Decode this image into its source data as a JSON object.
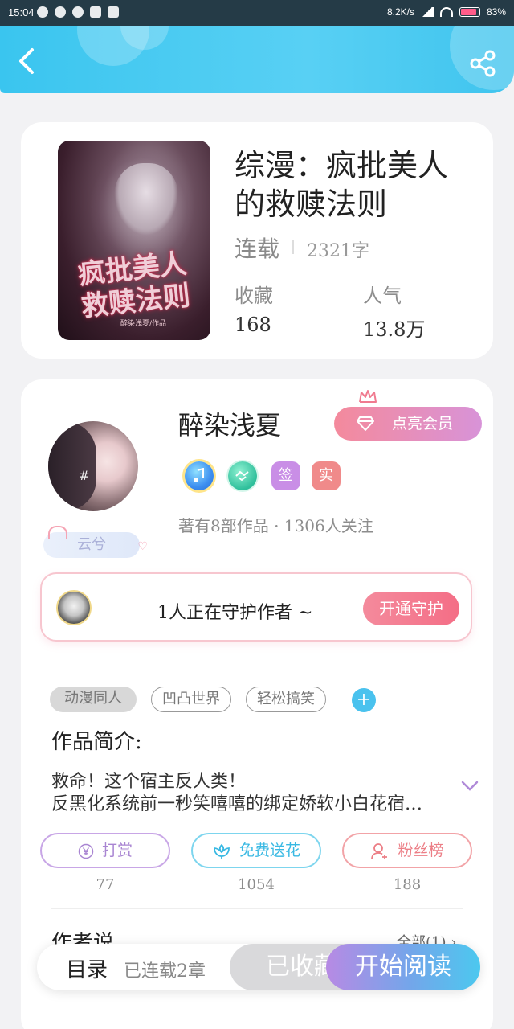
{
  "status_bar": {
    "time": "15:04",
    "speed": "8.2K/s",
    "battery": "83%"
  },
  "colors": {
    "header": "#3ac5ef",
    "vip": "#f48a9c",
    "accent": "#4ac2ee",
    "read": "#73a6ea"
  },
  "book": {
    "title_line1": "综漫：疯批美人",
    "title_line2": "的救赎法则",
    "status": "连载",
    "words": "2321字",
    "collect_label": "收藏",
    "collect_value": "168",
    "popularity_label": "人气",
    "popularity_value": "13.8万",
    "cover_title_line1": "疯批美人",
    "cover_title_line2": "救赎法则",
    "cover_author": "醉染浅夏/作品"
  },
  "author": {
    "name": "醉染浅夏",
    "vip_label": "点亮会员",
    "badge_sign": "签",
    "badge_real": "实",
    "meta": "著有8部作品 · 1306人关注",
    "nickname": "云兮"
  },
  "guard": {
    "text": "1人正在守护作者 ~",
    "button": "开通守护"
  },
  "tags": [
    "动漫同人",
    "凹凸世界",
    "轻松搞笑"
  ],
  "intro": {
    "title": "作品简介:",
    "line1": "救命！这个宿主反人类！",
    "line2": "反黑化系统前一秒笑嘻嘻的绑定娇软小白花宿…"
  },
  "actions": [
    {
      "label": "打赏",
      "count": "77"
    },
    {
      "label": "免费送花",
      "count": "1054"
    },
    {
      "label": "粉丝榜",
      "count": "188"
    }
  ],
  "author_says": {
    "title": "作者说",
    "see_all": "全部(1)"
  },
  "bottom_bar": {
    "catalog": "目录",
    "chapters": "已连载2章",
    "favorited": "已收藏",
    "start_reading": "开始阅读"
  }
}
